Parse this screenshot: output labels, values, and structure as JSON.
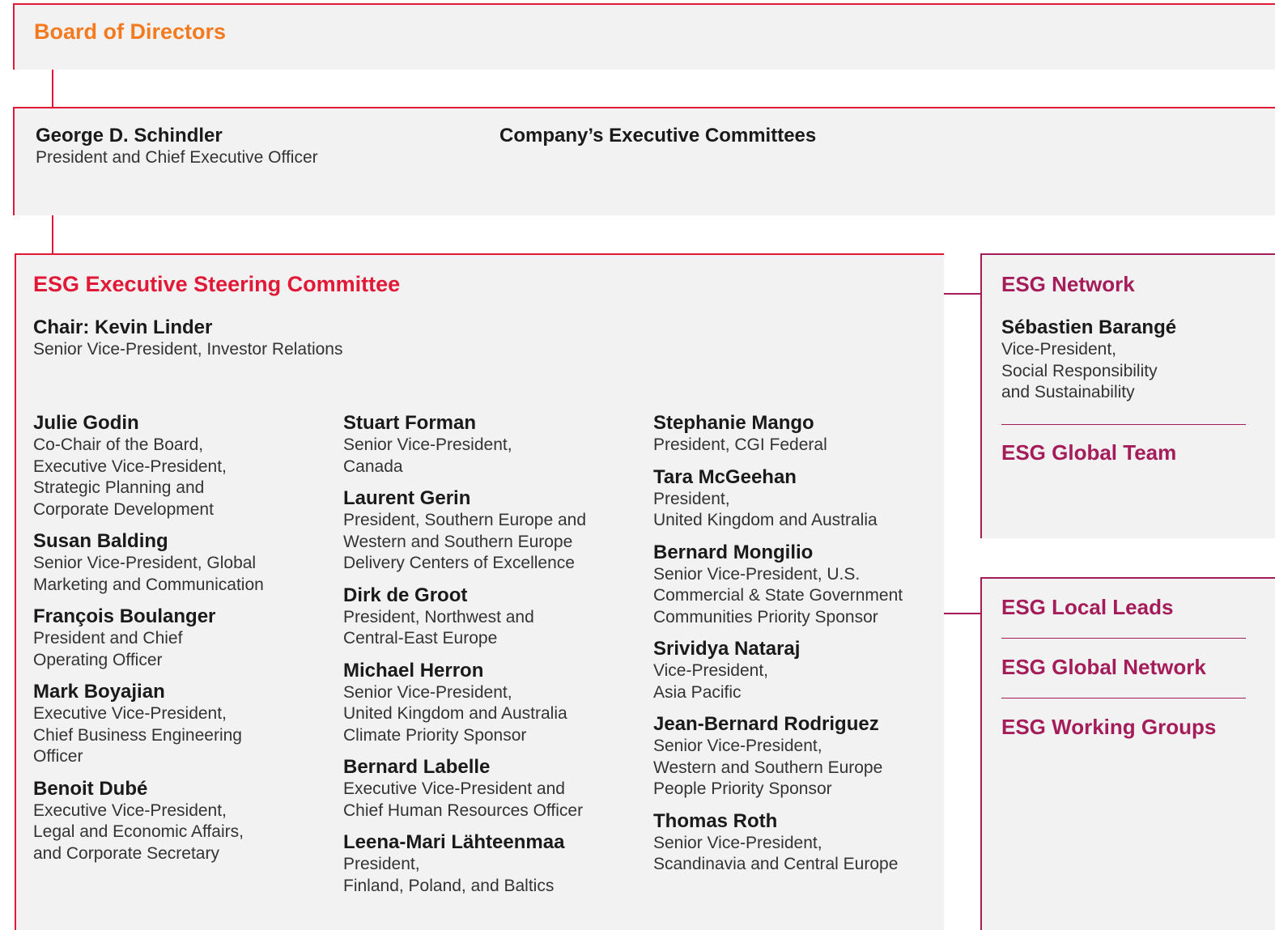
{
  "board": {
    "title": "Board of Directors"
  },
  "ceo": {
    "name": "George D. Schindler",
    "role": "President and Chief Executive Officer"
  },
  "exec_committees": {
    "title": "Company’s Executive Committees"
  },
  "steering": {
    "title": "ESG Executive Steering Committee",
    "chair": {
      "name": "Chair: Kevin Linder",
      "role": "Senior Vice-President, Investor Relations"
    },
    "columns": [
      [
        {
          "name": "Julie Godin",
          "role": "Co-Chair of the Board,\nExecutive Vice-President,\nStrategic Planning and\nCorporate Development"
        },
        {
          "name": "Susan Balding",
          "role": "Senior Vice-President, Global\nMarketing and Communication"
        },
        {
          "name": "François Boulanger",
          "role": "President and Chief\nOperating Officer"
        },
        {
          "name": "Mark Boyajian",
          "role": "Executive Vice-President,\nChief Business Engineering\nOfficer"
        },
        {
          "name": "Benoit Dubé",
          "role": "Executive Vice-President,\nLegal and Economic Affairs,\nand Corporate Secretary"
        }
      ],
      [
        {
          "name": "Stuart Forman",
          "role": "Senior Vice-President,\nCanada"
        },
        {
          "name": "Laurent Gerin",
          "role": "President, Southern Europe and\nWestern and Southern Europe\nDelivery Centers of Excellence"
        },
        {
          "name": "Dirk de Groot",
          "role": "President, Northwest and\nCentral-East Europe"
        },
        {
          "name": "Michael Herron",
          "role": "Senior Vice-President,\nUnited Kingdom and Australia\nClimate Priority Sponsor"
        },
        {
          "name": "Bernard Labelle",
          "role": "Executive Vice-President and\nChief Human Resources Officer"
        },
        {
          "name": "Leena-Mari Lähteenmaa",
          "role": "President,\nFinland, Poland, and Baltics"
        }
      ],
      [
        {
          "name": "Stephanie Mango",
          "role": "President, CGI Federal"
        },
        {
          "name": "Tara McGeehan",
          "role": "President,\nUnited Kingdom and Australia"
        },
        {
          "name": "Bernard Mongilio",
          "role": "Senior Vice-President, U.S.\nCommercial & State Government\nCommunities Priority Sponsor"
        },
        {
          "name": "Srividya Nataraj",
          "role": "Vice-President,\nAsia Pacific"
        },
        {
          "name": "Jean-Bernard Rodriguez",
          "role": "Senior Vice-President,\nWestern and Southern Europe\nPeople Priority Sponsor"
        },
        {
          "name": "Thomas Roth",
          "role": "Senior Vice-President,\nScandinavia and Central Europe"
        }
      ]
    ]
  },
  "network": {
    "title": "ESG Network",
    "lead": {
      "name": "Sébastien Barangé",
      "role": "Vice-President,\nSocial Responsibility\nand Sustainability"
    },
    "global_team": "ESG Global Team"
  },
  "local": {
    "items": [
      "ESG Local Leads",
      "ESG Global Network",
      "ESG Working Groups"
    ]
  },
  "colors": {
    "red": "#e11937",
    "orange": "#f47a20",
    "magenta": "#a41d5a",
    "panel": "#f2f2f2"
  }
}
